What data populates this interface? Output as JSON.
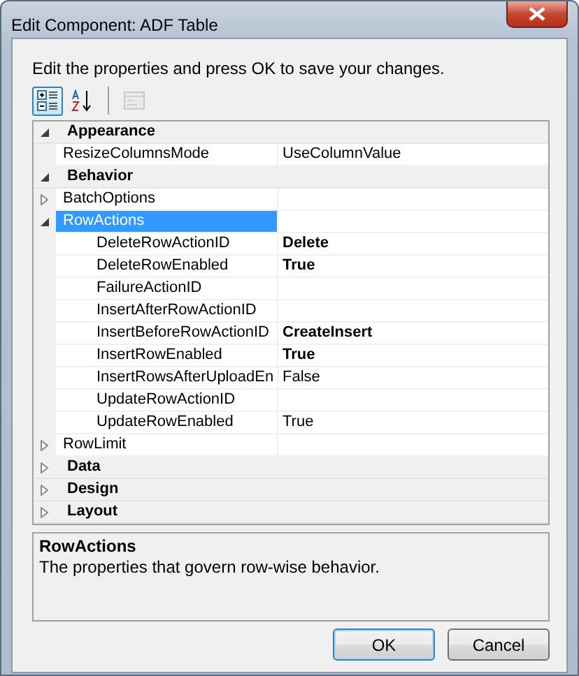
{
  "window": {
    "title": "Edit Component: ADF Table"
  },
  "instruction": "Edit the properties and press OK to save your changes.",
  "toolbar": [
    {
      "kind": "categorized",
      "selected": true,
      "disabled": false
    },
    {
      "kind": "alphabetical",
      "selected": false,
      "disabled": false
    },
    {
      "kind": "separator"
    },
    {
      "kind": "pages",
      "selected": false,
      "disabled": true
    }
  ],
  "properties": [
    {
      "kind": "category",
      "name": "Appearance",
      "expanded": true,
      "children": [
        {
          "kind": "property",
          "name": "ResizeColumnsMode",
          "value": "UseColumnValue",
          "modified": false,
          "selected": false
        }
      ]
    },
    {
      "kind": "category",
      "name": "Behavior",
      "expanded": true,
      "children": [
        {
          "kind": "property",
          "name": "BatchOptions",
          "expanded": false,
          "selected": false
        },
        {
          "kind": "property",
          "name": "RowActions",
          "expanded": true,
          "selected": true,
          "children": [
            {
              "kind": "property",
              "name": "DeleteRowActionID",
              "value": "Delete",
              "modified": true,
              "selected": false
            },
            {
              "kind": "property",
              "name": "DeleteRowEnabled",
              "value": "True",
              "modified": true,
              "selected": false
            },
            {
              "kind": "property",
              "name": "FailureActionID",
              "selected": false
            },
            {
              "kind": "property",
              "name": "InsertAfterRowActionID",
              "selected": false
            },
            {
              "kind": "property",
              "name": "InsertBeforeRowActionID",
              "value": "CreateInsert",
              "modified": true,
              "selected": false
            },
            {
              "kind": "property",
              "name": "InsertRowEnabled",
              "value": "True",
              "modified": true,
              "selected": false
            },
            {
              "kind": "property",
              "name": "InsertRowsAfterUploadEn",
              "value": "False",
              "modified": false,
              "selected": false
            },
            {
              "kind": "property",
              "name": "UpdateRowActionID",
              "selected": false
            },
            {
              "kind": "property",
              "name": "UpdateRowEnabled",
              "value": "True",
              "modified": false,
              "selected": false
            }
          ]
        },
        {
          "kind": "property",
          "name": "RowLimit",
          "expanded": false,
          "selected": false
        }
      ]
    },
    {
      "kind": "category",
      "name": "Data",
      "expanded": false
    },
    {
      "kind": "category",
      "name": "Design",
      "expanded": false
    },
    {
      "kind": "category",
      "name": "Layout",
      "expanded": false
    }
  ],
  "description": {
    "title": "RowActions",
    "text": "The properties that govern row-wise behavior."
  },
  "buttons": [
    {
      "label": "OK",
      "default": true
    },
    {
      "label": "Cancel",
      "default": false
    }
  ]
}
